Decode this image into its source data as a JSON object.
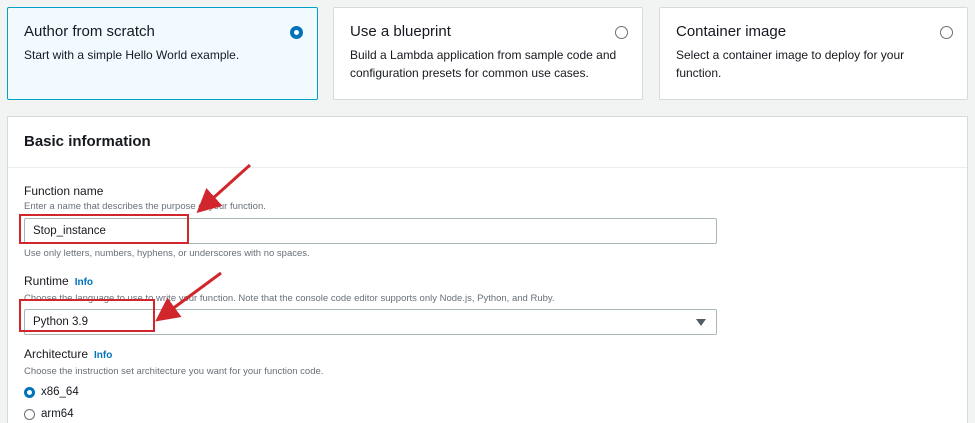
{
  "cards": [
    {
      "title": "Author from scratch",
      "desc": "Start with a simple Hello World example.",
      "selected": true
    },
    {
      "title": "Use a blueprint",
      "desc": "Build a Lambda application from sample code and configuration presets for common use cases.",
      "selected": false
    },
    {
      "title": "Container image",
      "desc": "Select a container image to deploy for your function.",
      "selected": false
    }
  ],
  "basic_info": {
    "title": "Basic information",
    "function_name": {
      "label": "Function name",
      "hint": "Enter a name that describes the purpose of your function.",
      "value": "Stop_instance",
      "constraint": "Use only letters, numbers, hyphens, or underscores with no spaces."
    },
    "runtime": {
      "label": "Runtime",
      "info": "Info",
      "hint": "Choose the language to use to write your function. Note that the console code editor supports only Node.js, Python, and Ruby.",
      "value": "Python 3.9"
    },
    "architecture": {
      "label": "Architecture",
      "info": "Info",
      "hint": "Choose the instruction set architecture you want for your function code.",
      "options": [
        "x86_64",
        "arm64"
      ],
      "selected": "x86_64"
    }
  },
  "colors": {
    "accent": "#0073bb",
    "annotation": "#d1262c"
  }
}
